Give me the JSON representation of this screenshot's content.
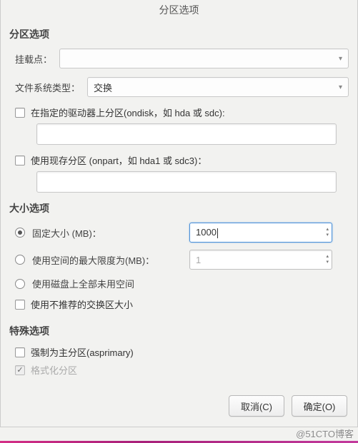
{
  "title": "分区选项",
  "sections": {
    "partition": {
      "title": "分区选项",
      "mount_label": "挂载点：",
      "mount_value": "",
      "fstype_label": "文件系统类型：",
      "fstype_value": "交换",
      "ondisk_label": "在指定的驱动器上分区(ondisk，如 hda 或 sdc):",
      "ondisk_value": "",
      "onpart_label": "使用现存分区 (onpart，如 hda1 或 sdc3)：",
      "onpart_value": ""
    },
    "size": {
      "title": "大小选项",
      "fixed_label": "固定大小 (MB)：",
      "fixed_value": "1000",
      "max_label": "使用空间的最大限度为(MB)：",
      "max_value": "1",
      "allfree_label": "使用磁盘上全部未用空间",
      "recommended_label": "使用不推荐的交换区大小"
    },
    "special": {
      "title": "特殊选项",
      "asprimary_label": "强制为主分区(asprimary)",
      "format_label": "格式化分区"
    }
  },
  "buttons": {
    "cancel": "取消(C)",
    "ok": "确定(O)"
  },
  "watermark": "@51CTO博客"
}
